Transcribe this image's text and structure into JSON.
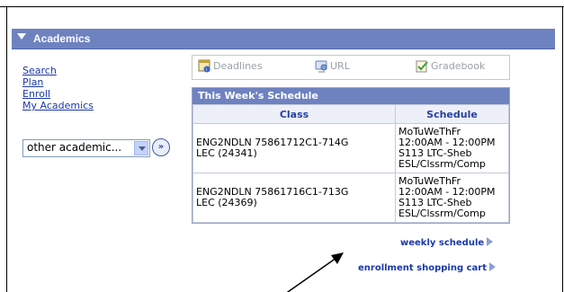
{
  "section": {
    "title": "Academics"
  },
  "nav": {
    "search": "Search",
    "plan": "Plan",
    "enroll": "Enroll",
    "my_academics": "My Academics"
  },
  "dropdown": {
    "value": "other academic...",
    "go_label": "»"
  },
  "tabs": {
    "deadlines": "Deadlines",
    "url": "URL",
    "gradebook": "Gradebook"
  },
  "schedule": {
    "caption": "This Week's Schedule",
    "columns": [
      "Class",
      "Schedule"
    ],
    "rows": [
      {
        "class_line1": "ENG2NDLN 75861712C1-714G",
        "class_line2": "LEC (24341)",
        "days": "MoTuWeThFr",
        "time": "12:00AM - 12:00PM",
        "room": "S113 LTC-Sheb",
        "location": "ESL/Clssrm/Comp"
      },
      {
        "class_line1": "ENG2NDLN 75861716C1-713G",
        "class_line2": "LEC (24369)",
        "days": "MoTuWeThFr",
        "time": "12:00AM - 12:00PM",
        "room": "S113 LTC-Sheb",
        "location": "ESL/Clssrm/Comp"
      }
    ]
  },
  "links": {
    "weekly_schedule": "weekly schedule",
    "enrollment_cart": "enrollment shopping cart"
  },
  "colors": {
    "header_bg": "#6e82c0",
    "link": "#1a38a8"
  }
}
